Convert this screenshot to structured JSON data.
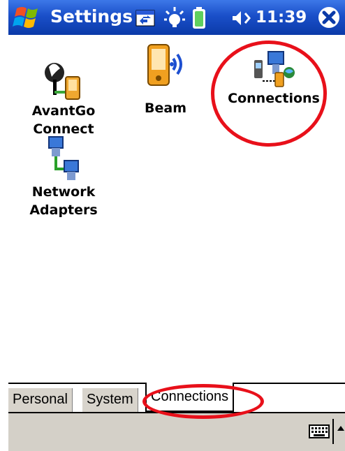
{
  "title_bar": {
    "title": "Settings",
    "time": "11:39",
    "icons": [
      "windows-start-icon",
      "sync-icon",
      "notification-icon",
      "battery-icon",
      "volume-icon",
      "close-icon"
    ],
    "colors": {
      "bar": "#1a4fc9",
      "text": "#ffffff"
    }
  },
  "apps": [
    {
      "label_line1": "AvantGo",
      "label_line2": "Connect",
      "icon": "avantgo-connect-icon"
    },
    {
      "label_line1": "Beam",
      "label_line2": "",
      "icon": "beam-icon"
    },
    {
      "label_line1": "Connections",
      "label_line2": "",
      "icon": "connections-icon"
    },
    {
      "label_line1": "Network",
      "label_line2": "Adapters",
      "icon": "network-adapters-icon"
    }
  ],
  "tabs": [
    {
      "label": "Personal",
      "active": false
    },
    {
      "label": "System",
      "active": false
    },
    {
      "label": "Connections",
      "active": true
    }
  ],
  "menu_bar": {
    "icons": [
      "keyboard-icon",
      "sip-arrow-up-icon"
    ],
    "color": "#d4d0c8"
  },
  "annotations": {
    "color": "#e8101a",
    "highlights": [
      "Connections icon",
      "Connections tab"
    ]
  }
}
